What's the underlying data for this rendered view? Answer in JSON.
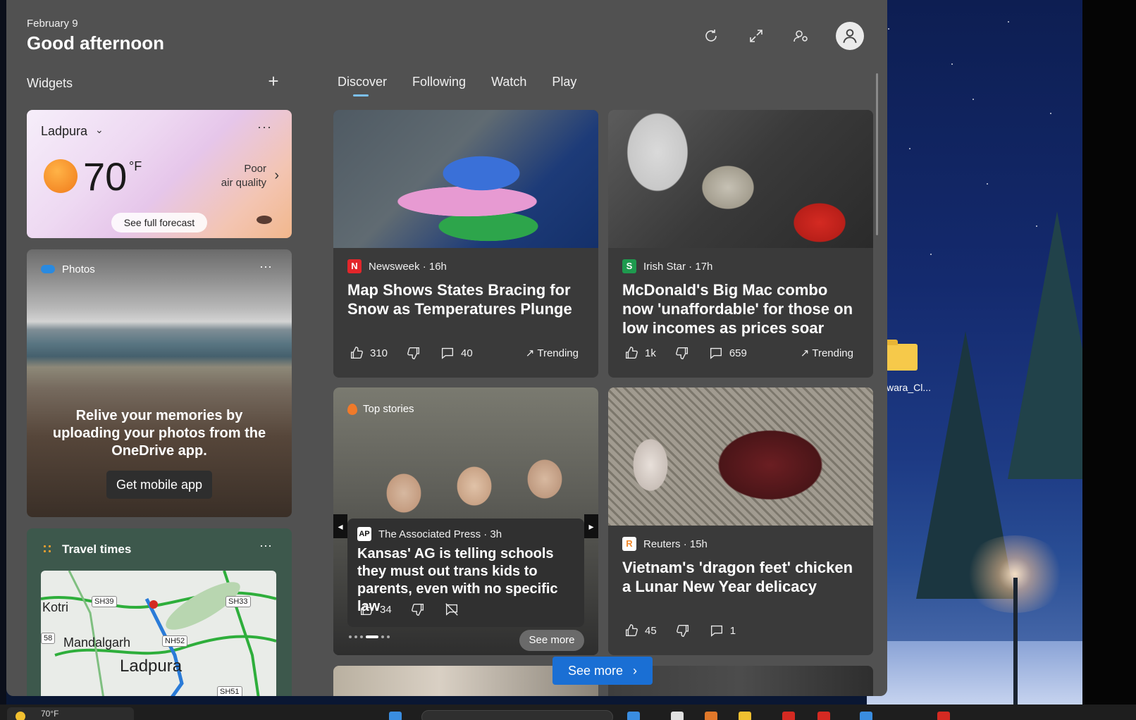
{
  "header": {
    "date": "February 9",
    "greeting": "Good afternoon"
  },
  "widgets": {
    "title": "Widgets",
    "add_label": "+"
  },
  "tabs": [
    {
      "label": "Discover",
      "active": true
    },
    {
      "label": "Following",
      "active": false
    },
    {
      "label": "Watch",
      "active": false
    },
    {
      "label": "Play",
      "active": false
    }
  ],
  "weather": {
    "city": "Ladpura",
    "temperature": "70",
    "unit": "°F",
    "air_quality_line1": "Poor",
    "air_quality_line2": "air quality",
    "forecast_button": "See full forecast"
  },
  "photos": {
    "title": "Photos",
    "message": "Relive your memories by uploading your photos from the OneDrive app.",
    "button": "Get mobile app"
  },
  "travel": {
    "title": "Travel times",
    "map_labels": [
      "Kotri",
      "Mandalgarh",
      "Ladpura",
      "SH39",
      "SH33",
      "NH52",
      "SH51",
      "58"
    ]
  },
  "news": [
    {
      "source": "Newsweek",
      "age": "16h",
      "logo_text": "N",
      "logo_color": "#e2262a",
      "title": "Map Shows States Bracing for Snow as Temperatures Plunge",
      "likes": "310",
      "comments": "40",
      "trending": "Trending"
    },
    {
      "source": "Irish Star",
      "age": "17h",
      "logo_text": "S",
      "logo_color": "#1e9a4e",
      "title": "McDonald's Big Mac combo now 'unaffordable' for those on low incomes as prices soar",
      "likes": "1k",
      "comments": "659",
      "trending": "Trending"
    },
    {
      "badge": "Top stories",
      "source": "The Associated Press",
      "age": "3h",
      "logo_text": "AP",
      "logo_color": "#ffffff",
      "title": "Kansas' AG is telling schools they must out trans kids to parents, even with no specific law",
      "likes": "34",
      "see_more": "See more"
    },
    {
      "source": "Reuters",
      "age": "15h",
      "logo_text": "R",
      "logo_color": "#f28a2c",
      "title": "Vietnam's 'dragon feet' chicken a Lunar New Year delicacy",
      "likes": "45",
      "comments": "1"
    }
  ],
  "see_more_main": "See more",
  "desktop": {
    "folder_label": "wara_Cl..."
  },
  "taskbar": {
    "weather": "70°F"
  }
}
